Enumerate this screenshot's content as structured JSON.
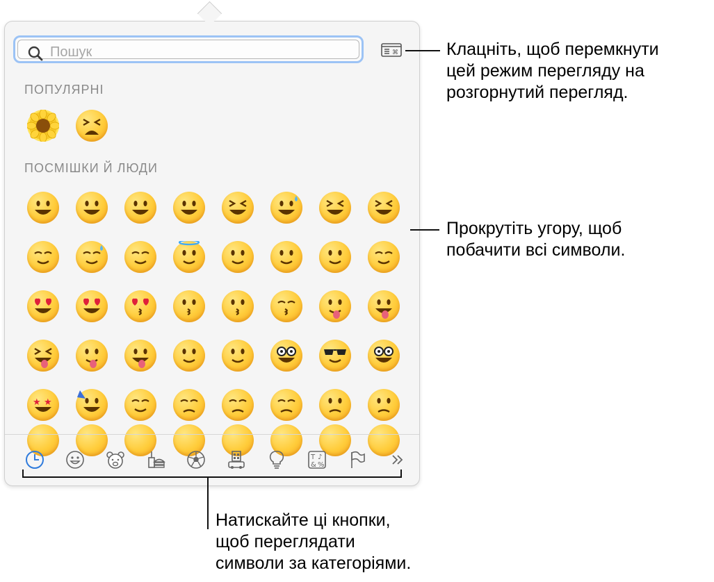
{
  "search": {
    "placeholder": "Пошук"
  },
  "sections": [
    {
      "title": "ПОПУЛЯРНІ"
    },
    {
      "title": "ПОСМІШКИ Й ЛЮДИ"
    }
  ],
  "popular": [
    "sunflower",
    "tired-face"
  ],
  "smileys": [
    [
      "grinning",
      "smiley",
      "smile",
      "grin",
      "laughing",
      "sweat-smile",
      "joy",
      "rofl"
    ],
    [
      "relaxed",
      "smiling-tear",
      "blush",
      "innocent",
      "slightly-smiling",
      "upside-down",
      "wink",
      "relieved"
    ],
    [
      "heart-eyes",
      "smiling-hearts",
      "kissing-heart",
      "kissing",
      "kissing-smiling-eyes",
      "kissing-closed-eyes",
      "yum",
      "tongue"
    ],
    [
      "squinting-tongue",
      "winking-tongue",
      "zany",
      "raised-eyebrow",
      "monocle",
      "nerd",
      "sunglasses",
      "disguised"
    ],
    [
      "star-struck",
      "partying",
      "smirk",
      "unamused",
      "disappointed",
      "pensive",
      "worried",
      "confused"
    ],
    [
      "partial-1",
      "partial-2",
      "partial-3",
      "partial-4",
      "partial-5",
      "partial-6",
      "partial-7",
      "partial-8"
    ]
  ],
  "tabs": [
    "clock-icon",
    "smiley-icon",
    "bear-icon",
    "food-icon",
    "ball-icon",
    "building-icon",
    "lightbulb-icon",
    "symbols-icon",
    "flag-icon",
    "more-icon"
  ],
  "callouts": {
    "toggle": "Клацніть, щоб перемкнути\nцей режим перегляду на\nрозгорнутий перегляд.",
    "scroll": "Прокрутіть угору, щоб\nпобачити всі символи.",
    "tabs": "Натискайте ці кнопки,\nщоб переглядати\nсимволи за категоріями."
  },
  "colors": {
    "accent": "#2f7bdc",
    "search_focus": "#9cc3f5",
    "emoji_yellow": "#ffcc3a"
  }
}
